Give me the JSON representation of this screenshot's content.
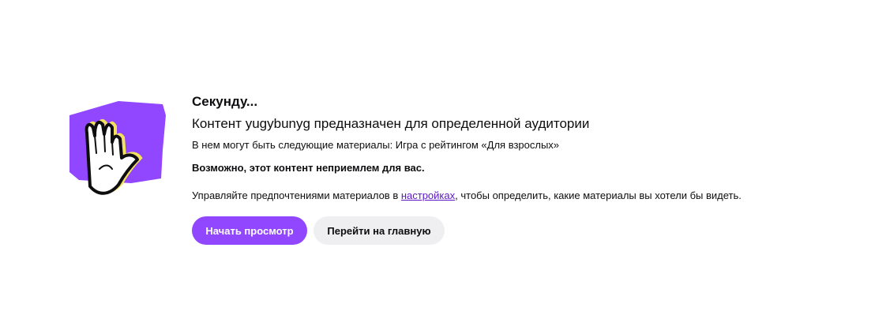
{
  "gate": {
    "illustration_icon": "raised-hand-stop-icon",
    "title": "Секунду...",
    "subtitle_before": "Контент ",
    "channel_name": "yugybunyg",
    "subtitle_after": " предназначен для определенной аудитории",
    "description": "В нем могут быть следующие материалы: Игра с рейтингом «Для взрослых»",
    "warning": "Возможно, этот контент неприемлем для вас.",
    "prefs_before": "Управляйте предпочтениями материалов в ",
    "prefs_link": "настройках",
    "prefs_after": ", чтобы определить, какие материалы вы хотели бы видеть.",
    "start_button": "Начать просмотр",
    "home_button": "Перейти на главную"
  },
  "colors": {
    "accent": "#9147ff",
    "link": "#5c16c5",
    "secondary_button": "#efeff1",
    "text": "#0e0e10"
  }
}
